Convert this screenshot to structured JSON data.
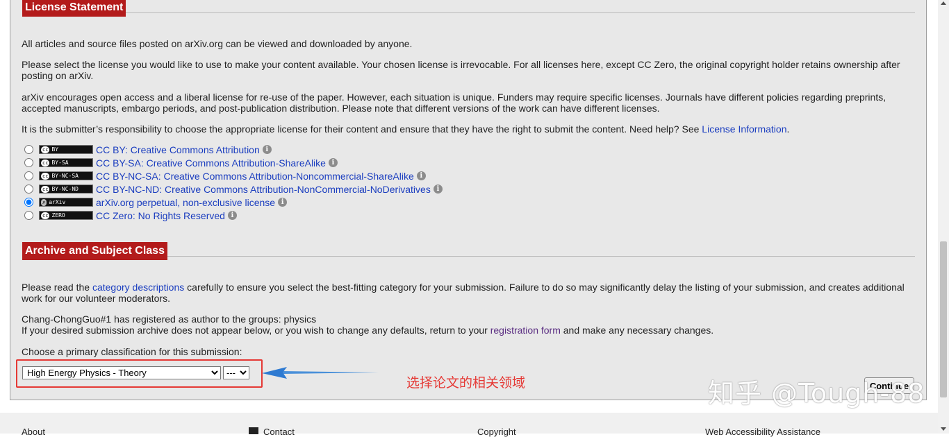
{
  "license_section": {
    "title": "License Statement",
    "p1": "All articles and source files posted on arXiv.org can be viewed and downloaded by anyone.",
    "p2": "Please select the license you would like to use to make your content available. Your chosen license is irrevocable. For all licenses here, except CC Zero, the original copyright holder retains ownership after posting on arXiv.",
    "p3": "arXiv encourages open access and a liberal license for re-use of the paper. However, each situation is unique. Funders may require specific licenses. Journals have different policies regarding preprints, accepted manuscripts, embargo periods, and post-publication distribution. Please note that different versions of the work can have different licenses.",
    "p4_pre": "It is the submitter’s responsibility to choose the appropriate license for their content and ensure that they have the right to submit the content. Need help? See ",
    "p4_link": "License Information",
    "p4_post": ".",
    "licenses": [
      {
        "badge": "BY",
        "label": "CC BY: Creative Commons Attribution",
        "selected": false
      },
      {
        "badge": "BY-SA",
        "label": "CC BY-SA: Creative Commons Attribution-ShareAlike",
        "selected": false
      },
      {
        "badge": "BY-NC-SA",
        "label": "CC BY-NC-SA: Creative Commons Attribution-Noncommercial-ShareAlike",
        "selected": false
      },
      {
        "badge": "BY-NC-ND",
        "label": "CC BY-NC-ND: Creative Commons Attribution-NonCommercial-NoDerivatives",
        "selected": false
      },
      {
        "badge": "arXiv",
        "label": "arXiv.org perpetual, non-exclusive license",
        "selected": true
      },
      {
        "badge": "ZERO",
        "label": "CC Zero: No Rights Reserved",
        "selected": false
      }
    ]
  },
  "archive_section": {
    "title": "Archive and Subject Class",
    "p1_pre": "Please read the ",
    "p1_link": "category descriptions",
    "p1_post": " carefully to ensure you select the best-fitting category for your submission. Failure to do so may significantly delay the listing of your submission, and creates additional work for our volunteer moderators.",
    "p2_line1": "Chang-ChongGuo#1 has registered as author to the groups: physics",
    "p2_line2_pre": "If your desired submission archive does not appear below, or you wish to change any defaults, return to your ",
    "p2_link": "registration form",
    "p2_line2_post": " and make any necessary changes.",
    "choose_label": "Choose a primary classification for this submission:",
    "primary_selected": "High Energy Physics - Theory",
    "secondary_selected": "---",
    "continue_label": "Continue"
  },
  "annotation": {
    "text": "选择论文的相关领域",
    "color": "#e53935"
  },
  "watermark": "知乎 @Tough-88",
  "footer": {
    "about": "About",
    "contact": "Contact",
    "copyright": "Copyright",
    "accessibility": "Web Accessibility Assistance"
  },
  "colors": {
    "accent": "#b31b1b",
    "link": "#1a3dbf",
    "panel_bg": "#e8e8e8"
  }
}
